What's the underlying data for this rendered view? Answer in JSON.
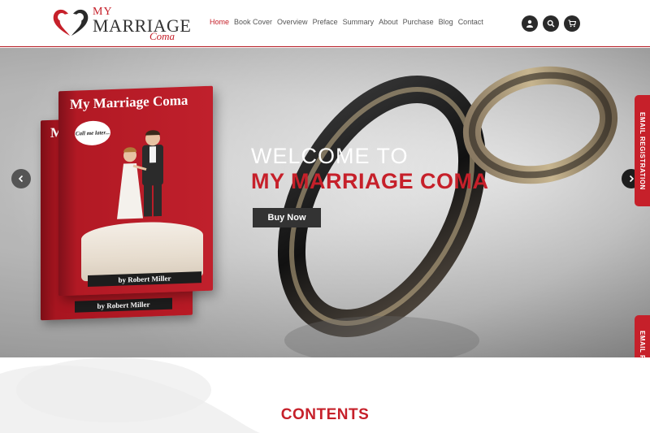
{
  "logo": {
    "my": "MY",
    "marriage": "MARRIAGE",
    "coma": "Coma"
  },
  "nav": {
    "items": [
      "Home",
      "Book Cover",
      "Overview",
      "Preface",
      "Summary",
      "About",
      "Purchase",
      "Blog",
      "Contact"
    ],
    "active": "Home"
  },
  "header_icons": [
    "user-icon",
    "search-icon",
    "cart-icon"
  ],
  "hero": {
    "welcome": "WELCOME TO",
    "title": "MY MARRIAGE COMA",
    "buy_button": "Buy Now",
    "book": {
      "title": "My Marriage Coma",
      "bubble": "Call me later...",
      "author": "by Robert Miller"
    }
  },
  "side_tabs": [
    "EMAIL REGISTRATION",
    "EMAIL REGISTRATION"
  ],
  "contents": {
    "title": "CONTENTS"
  },
  "colors": {
    "accent": "#c6202a",
    "dark": "#333333"
  }
}
